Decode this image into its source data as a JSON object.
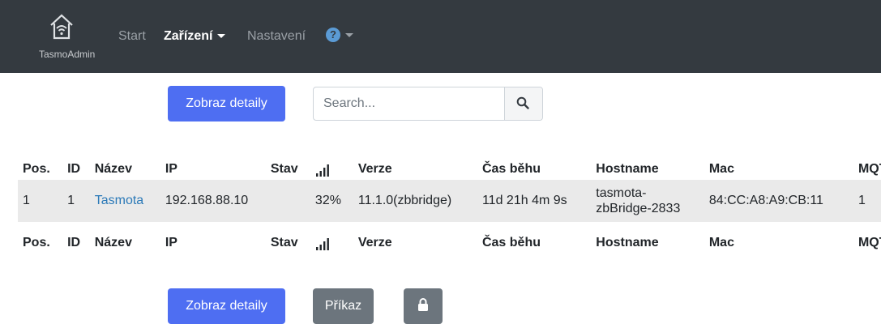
{
  "navbar": {
    "brand": "TasmoAdmin",
    "items": [
      {
        "label": "Start",
        "active": false,
        "dropdown": false
      },
      {
        "label": "Zařízení",
        "active": true,
        "dropdown": true
      },
      {
        "label": "Nastavení",
        "active": false,
        "dropdown": false
      }
    ],
    "help_dropdown": {
      "icon": "question-circle-icon"
    }
  },
  "toolbar": {
    "details_label": "Zobraz detaily",
    "search_placeholder": "Search...",
    "search_icon": "search-icon"
  },
  "table": {
    "columns": [
      "Pos.",
      "ID",
      "Název",
      "IP",
      "Stav",
      "signal-icon",
      "Verze",
      "Čas běhu",
      "Hostname",
      "Mac",
      "MQTT"
    ],
    "rows": [
      {
        "pos": "1",
        "id": "1",
        "name": "Tasmota",
        "ip": "192.168.88.10",
        "state": "",
        "signal": "32%",
        "version": "11.1.0(zbbridge)",
        "uptime": "11d 21h 4m 9s",
        "hostname_line1": "tasmota-",
        "hostname_line2": "zbBridge-2833",
        "mac": "84:CC:A8:A9:CB:11",
        "mqtt": "1"
      }
    ]
  },
  "bottom": {
    "details_label": "Zobraz detaily",
    "command_label": "Příkaz",
    "lock_icon": "lock-icon"
  },
  "colors": {
    "navbar_bg": "#343a40",
    "primary": "#4e6ef2",
    "secondary": "#6c757d",
    "link": "#2c7ab8",
    "row_bg": "#eaeaea"
  }
}
